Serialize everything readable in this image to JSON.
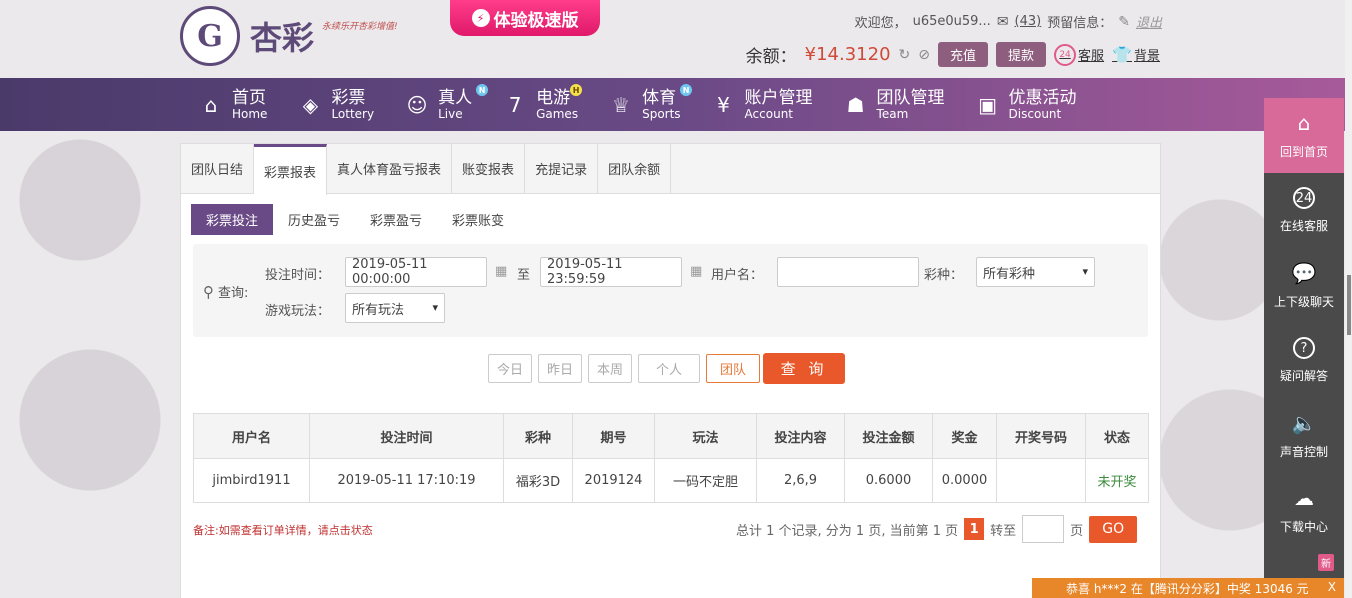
{
  "header": {
    "logo_name": "杏彩",
    "logo_slogan": "永续乐开杏彩增值!",
    "fast_version": "体验极速版",
    "welcome": "欢迎您，",
    "username": "u65e0u59...",
    "mail_count": "(43)",
    "reserve_info": "预留信息：",
    "logout": "退出",
    "balance_label": "余额：",
    "balance_value": "¥14.3120",
    "recharge": "充值",
    "withdraw": "提款",
    "service": "客服",
    "background": "背景"
  },
  "nav": [
    {
      "zh": "首页",
      "en": "Home",
      "icon": "home-icon"
    },
    {
      "zh": "彩票",
      "en": "Lottery",
      "icon": "ticket-icon"
    },
    {
      "zh": "真人",
      "en": "Live",
      "icon": "dealer-icon",
      "badge": "N"
    },
    {
      "zh": "电游",
      "en": "Games",
      "icon": "slot-icon",
      "badge": "H"
    },
    {
      "zh": "体育",
      "en": "Sports",
      "icon": "trophy-icon",
      "badge": "N"
    },
    {
      "zh": "账户管理",
      "en": "Account",
      "icon": "yen-icon"
    },
    {
      "zh": "团队管理",
      "en": "Team",
      "icon": "team-icon"
    },
    {
      "zh": "优惠活动",
      "en": "Discount",
      "icon": "gift-icon"
    }
  ],
  "tabs": [
    "团队日结",
    "彩票报表",
    "真人体育盈亏报表",
    "账变报表",
    "充提记录",
    "团队余额"
  ],
  "subtabs": [
    "彩票投注",
    "历史盈亏",
    "彩票盈亏",
    "彩票账变"
  ],
  "query": {
    "label": "查询:",
    "bet_time_label": "投注时间：",
    "start": "2019-05-11 00:00:00",
    "to": "至",
    "end": "2019-05-11 23:59:59",
    "user_label": "用户名：",
    "user_value": "",
    "lottery_label": "彩种：",
    "lottery_value": "所有彩种",
    "play_label": "游戏玩法：",
    "play_value": "所有玩法"
  },
  "quick_buttons": [
    "今日",
    "昨日",
    "本周",
    "个人",
    "团队"
  ],
  "search_button": "查 询",
  "table": {
    "headers": [
      "用户名",
      "投注时间",
      "彩种",
      "期号",
      "玩法",
      "投注内容",
      "投注金额",
      "奖金",
      "开奖号码",
      "状态"
    ],
    "rows": [
      [
        "jimbird1911",
        "2019-05-11 17:10:19",
        "福彩3D",
        "2019124",
        "一码不定胆",
        "2,6,9",
        "0.6000",
        "0.0000",
        "",
        "未开奖"
      ]
    ]
  },
  "note": "备注:如需查看订单详情，请点击状态",
  "pager": {
    "summary": "总计 1 个记录, 分为 1 页, 当前第 1 页",
    "current": "1",
    "goto": "转至",
    "page_unit": "页",
    "go": "GO"
  },
  "sidebar": [
    {
      "label": "回到首页",
      "icon": "home-icon"
    },
    {
      "label": "在线客服",
      "icon": "headset-icon"
    },
    {
      "label": "上下级聊天",
      "icon": "chat-icon"
    },
    {
      "label": "疑问解答",
      "icon": "question-icon"
    },
    {
      "label": "声音控制",
      "icon": "speaker-icon"
    },
    {
      "label": "下载中心",
      "icon": "download-icon"
    }
  ],
  "sidebar_new": "新",
  "ticker": "恭喜 h***2 在【腾讯分分彩】中奖 13046 元",
  "ticker_close": "X"
}
